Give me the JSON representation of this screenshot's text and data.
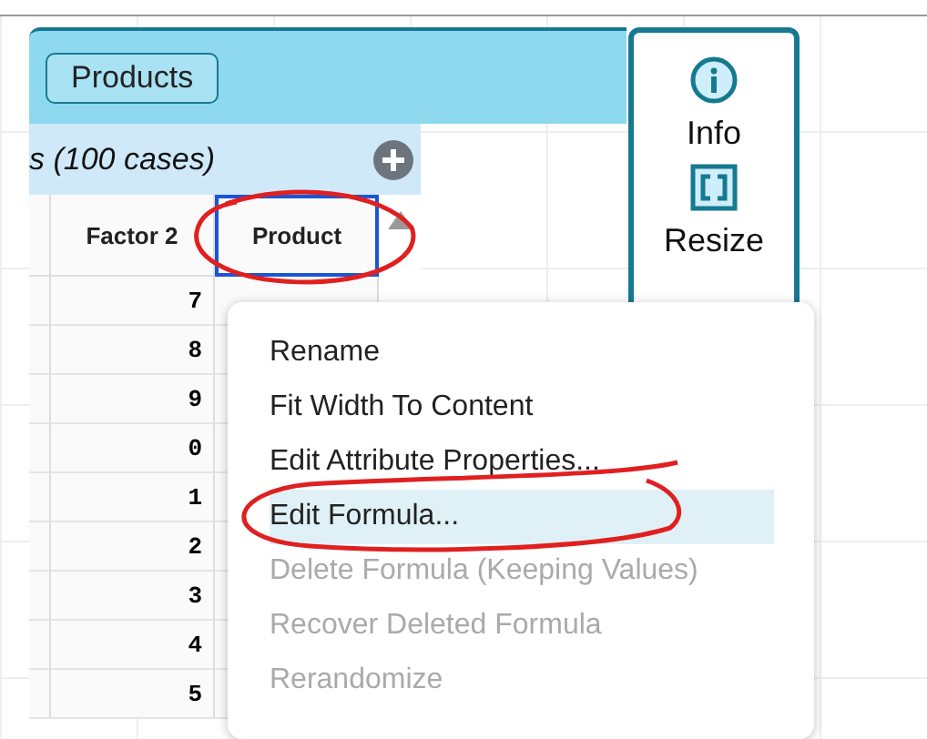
{
  "table": {
    "title": "Products",
    "collection_title": "s (100 cases)",
    "columns": [
      {
        "name": "Factor 2",
        "selected": false
      },
      {
        "name": "Product",
        "selected": true
      }
    ],
    "rows": [
      {
        "factor_2": "7"
      },
      {
        "factor_2": "8"
      },
      {
        "factor_2": "9"
      },
      {
        "factor_2": "0"
      },
      {
        "factor_2": "1"
      },
      {
        "factor_2": "2"
      },
      {
        "factor_2": "3"
      },
      {
        "factor_2": "4"
      },
      {
        "factor_2": "5"
      }
    ]
  },
  "inspector": [
    {
      "label": "Info",
      "kind": "info"
    },
    {
      "label": "Resize",
      "kind": "resize"
    }
  ],
  "context_menu": [
    {
      "label": "Rename",
      "disabled": false,
      "selected": false
    },
    {
      "label": "Fit Width To Content",
      "disabled": false,
      "selected": false
    },
    {
      "label": "Edit Attribute Properties...",
      "disabled": false,
      "selected": false
    },
    {
      "label": "Edit Formula...",
      "disabled": false,
      "selected": true
    },
    {
      "label": "Delete Formula (Keeping Values)",
      "disabled": true,
      "selected": false
    },
    {
      "label": "Recover Deleted Formula",
      "disabled": true,
      "selected": false
    },
    {
      "label": "Rerandomize",
      "disabled": true,
      "selected": false
    }
  ]
}
